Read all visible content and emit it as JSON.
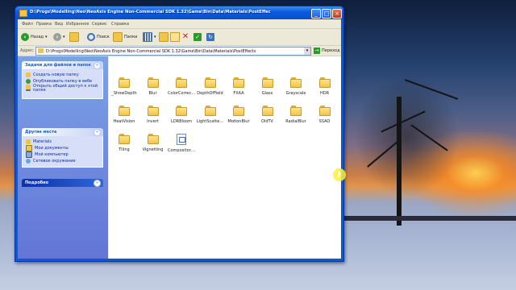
{
  "window": {
    "title": "D:\\Progs\\Modelling\\Neo\\NeoAxis Engine Non-Commercial SDK 1.32\\Game\\Bin\\Data\\Materials\\PostEffec"
  },
  "menu": [
    "Файл",
    "Правка",
    "Вид",
    "Избранное",
    "Сервис",
    "Справка"
  ],
  "toolbar": {
    "back_label": "Назад",
    "search_label": "Поиск",
    "folders_label": "Папки"
  },
  "address": {
    "label": "Адрес:",
    "value": "D:\\Progs\\Modelling\\Neo\\NeoAxis Engine Non-Commercial SDK 1.32\\Game\\Bin\\Data\\Materials\\PostEffects",
    "go_label": "Переход"
  },
  "taskpane": {
    "tasks_title": "Задачи для файлов и папок",
    "tasks": [
      "Создать новую папку",
      "Опубликовать папку в вебе",
      "Открыть общий доступ к этой папке"
    ],
    "places_title": "Другие места",
    "places": [
      "Materials",
      "Мои документы",
      "Мой компьютер",
      "Сетевое окружение"
    ],
    "details_title": "Подробно"
  },
  "files": [
    {
      "name": "_ShowDepth",
      "type": "folder"
    },
    {
      "name": "Blur",
      "type": "folder"
    },
    {
      "name": "ColorCorrec...",
      "type": "folder"
    },
    {
      "name": "DepthOfField",
      "type": "folder"
    },
    {
      "name": "FXAA",
      "type": "folder"
    },
    {
      "name": "Glass",
      "type": "folder"
    },
    {
      "name": "Grayscale",
      "type": "folder"
    },
    {
      "name": "HDR",
      "type": "folder"
    },
    {
      "name": "HeatVision",
      "type": "folder"
    },
    {
      "name": "Invert",
      "type": "folder"
    },
    {
      "name": "LDRBloom",
      "type": "folder"
    },
    {
      "name": "LightScatte...",
      "type": "folder"
    },
    {
      "name": "MotionBlur",
      "type": "folder"
    },
    {
      "name": "OldTV",
      "type": "folder"
    },
    {
      "name": "RadialBlur",
      "type": "folder"
    },
    {
      "name": "SSAO",
      "type": "folder"
    },
    {
      "name": "Tiling",
      "type": "folder"
    },
    {
      "name": "Vignetting",
      "type": "folder"
    },
    {
      "name": "Compositor....",
      "type": "document"
    }
  ],
  "colors": {
    "titlebar": "#0a5ce0",
    "taskpane": "#6375d6",
    "folder": "#f0c54a"
  }
}
